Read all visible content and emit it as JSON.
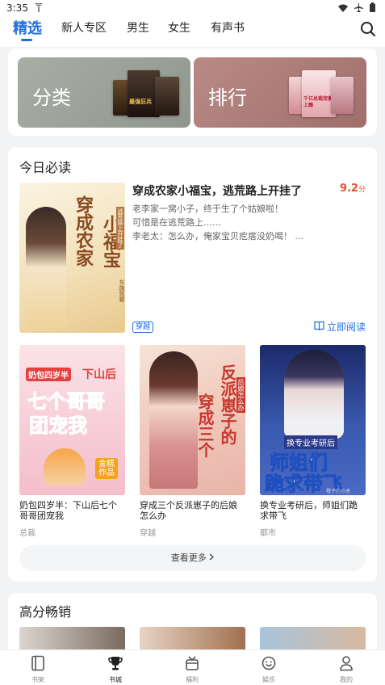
{
  "status_bar": {
    "time": "3:35"
  },
  "tabs": [
    {
      "label": "精选",
      "active": true
    },
    {
      "label": "新人专区",
      "active": false
    },
    {
      "label": "男生",
      "active": false
    },
    {
      "label": "女生",
      "active": false
    },
    {
      "label": "有声书",
      "active": false
    }
  ],
  "banners": {
    "category": {
      "label": "分类",
      "cover_text": "最强狂兵"
    },
    "ranking": {
      "label": "排行",
      "cover_text": "千亿总裁宠妻上瘾"
    }
  },
  "today": {
    "section_title": "今日必读",
    "featured": {
      "title": "穿成农家小福宝，逃荒路上开挂了",
      "score": "9.2",
      "score_unit": "分",
      "desc_lines": [
        "老李家一窝小子，终于生了个姑娘啦！",
        "可惜是在逃荒路上……",
        "李老太：怎么办，俺家宝贝疙瘩没奶喝！ ..."
      ],
      "tag": "穿越",
      "read_label": "立即阅读",
      "cover_text": {
        "main": "穿成农家",
        "sub": "小福宝",
        "side": "逃荒路上开挂了",
        "author": "东施效颦"
      }
    },
    "books": [
      {
        "title": "奶包四岁半：下山后七个哥哥团宠我",
        "category": "总裁",
        "cover_top": "奶包四岁半",
        "cover_mid": "下山后",
        "cover_main": "七个哥哥",
        "cover_main2": "团宠我",
        "cover_author": "金糕作品"
      },
      {
        "title": "穿成三个反派崽子的后娘怎么办",
        "category": "穿越",
        "cover_main": "穿成三个",
        "cover_main2": "反派崽子的",
        "cover_side": "后娘怎么办"
      },
      {
        "title": "换专业考研后，师姐们跪求带飞",
        "category": "都市",
        "cover_top": "换专业考研后",
        "cover_main": "师姐们",
        "cover_main2": "跪求带飞",
        "cover_author": "橙子的小虎"
      }
    ],
    "more_label": "查看更多"
  },
  "bestseller": {
    "section_title": "高分畅销"
  },
  "bottom_nav": [
    {
      "label": "书架",
      "icon": "bookshelf-icon",
      "active": false
    },
    {
      "label": "书城",
      "icon": "trophy-icon",
      "active": true
    },
    {
      "label": "福利",
      "icon": "gift-icon",
      "active": false
    },
    {
      "label": "娱乐",
      "icon": "smile-icon",
      "active": false
    },
    {
      "label": "我的",
      "icon": "user-icon",
      "active": false
    }
  ],
  "colors": {
    "accent": "#1f6fe0",
    "score": "#e8502f"
  }
}
